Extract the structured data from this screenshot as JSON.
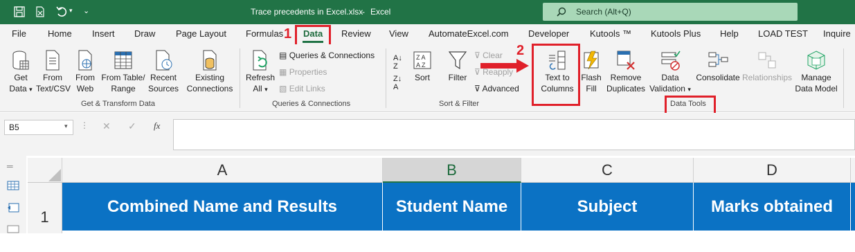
{
  "titlebar": {
    "filename": "Trace precedents in Excel.xlsx",
    "separator": "-",
    "app": "Excel",
    "search_placeholder": "Search (Alt+Q)"
  },
  "tabs": [
    "File",
    "Home",
    "Insert",
    "Draw",
    "Page Layout",
    "Formulas",
    "Data",
    "Review",
    "View",
    "AutomateExcel.com",
    "Developer",
    "Kutools ™",
    "Kutools Plus",
    "Help",
    "LOAD TEST",
    "Inquire"
  ],
  "ribbon": {
    "get_data": [
      "Get",
      "Data"
    ],
    "from_text": [
      "From",
      "Text/CSV"
    ],
    "from_web": [
      "From",
      "Web"
    ],
    "from_table": [
      "From Table/",
      "Range"
    ],
    "recent_sources": [
      "Recent",
      "Sources"
    ],
    "existing_connections": [
      "Existing",
      "Connections"
    ],
    "group_get_transform": "Get & Transform Data",
    "refresh_all": [
      "Refresh",
      "All"
    ],
    "queries_connections": "Queries & Connections",
    "properties": "Properties",
    "edit_links": "Edit Links",
    "group_queries": "Queries & Connections",
    "sort": "Sort",
    "filter": "Filter",
    "clear": "Clear",
    "reapply": "Reapply",
    "advanced": "Advanced",
    "group_sort_filter": "Sort & Filter",
    "text_to_columns": [
      "Text to",
      "Columns"
    ],
    "flash_fill": [
      "Flash",
      "Fill"
    ],
    "remove_duplicates": [
      "Remove",
      "Duplicates"
    ],
    "data_validation": [
      "Data",
      "Validation"
    ],
    "consolidate": "Consolidate",
    "relationships": "Relationships",
    "manage_data_model": [
      "Manage",
      "Data Model"
    ],
    "group_data_tools": "Data Tools"
  },
  "annotations": {
    "step1": "1",
    "step2": "2"
  },
  "formula_bar": {
    "name_box": "B5",
    "fx": "fx",
    "value": ""
  },
  "sheet": {
    "columns": [
      "A",
      "B",
      "C",
      "D"
    ],
    "row1_number": "1",
    "headers": [
      "Combined Name and Results",
      "Student Name",
      "Subject",
      "Marks obtained"
    ]
  },
  "colors": {
    "excel_green": "#217346",
    "header_blue": "#0b72c4",
    "annotation_red": "#e0202a"
  }
}
